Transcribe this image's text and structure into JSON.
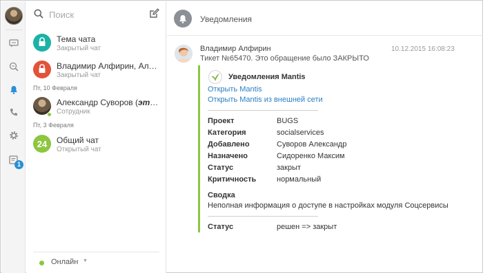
{
  "sidebar": {
    "badge_count": "1"
  },
  "search": {
    "placeholder": "Поиск"
  },
  "chats": [
    {
      "name": "Тема чата",
      "sub": "Закрытый чат",
      "avatar_color": "#1ab3a6",
      "icon": "lock-icon"
    },
    {
      "name": "Владимир Алфирин, Алекс...",
      "sub": "Закрытый чат",
      "avatar_color": "#e2533a",
      "icon": "lock-icon"
    },
    {
      "name_plain": "Александр Суворов (",
      "name_em": "это в...",
      "sub": "Сотрудник",
      "date_before": "Пт, 10 Февраля"
    },
    {
      "name": "Общий чат",
      "sub": "Открытый чат",
      "avatar_color": "#8dc63f",
      "avatar_text": "24",
      "date_before": "Пт, 3 Февраля"
    }
  ],
  "status": {
    "label": "Онлайн"
  },
  "main": {
    "title": "Уведомления",
    "message": {
      "author": "Владимир Алфирин",
      "time": "10.12.2015 16:08:23",
      "text": "Тикет №65470. Это обращение было ЗАКРЫТО",
      "card": {
        "title": "Уведомления Mantis",
        "link1": "Открыть Mantis",
        "link2": "Открыть Mantis из внешней сети",
        "fields": [
          {
            "key": "Проект",
            "value": "BUGS"
          },
          {
            "key": "Категория",
            "value": "socialservices"
          },
          {
            "key": "Добавлено",
            "value": "Суворов Александр"
          },
          {
            "key": "Назначено",
            "value": "Сидоренко Максим"
          },
          {
            "key": "Статус",
            "value": "закрыт"
          },
          {
            "key": "Критичность",
            "value": "нормальный"
          }
        ],
        "summary_label": "Сводка",
        "summary_text": "Неполная информация о доступе в настройках модуля Соцсервисы",
        "change_key": "Статус",
        "change_value": "решен => закрыт"
      }
    }
  },
  "colors": {
    "accent_green": "#8dc63f",
    "link_blue": "#2a7fc1",
    "badge_blue": "#2a8fd6"
  }
}
